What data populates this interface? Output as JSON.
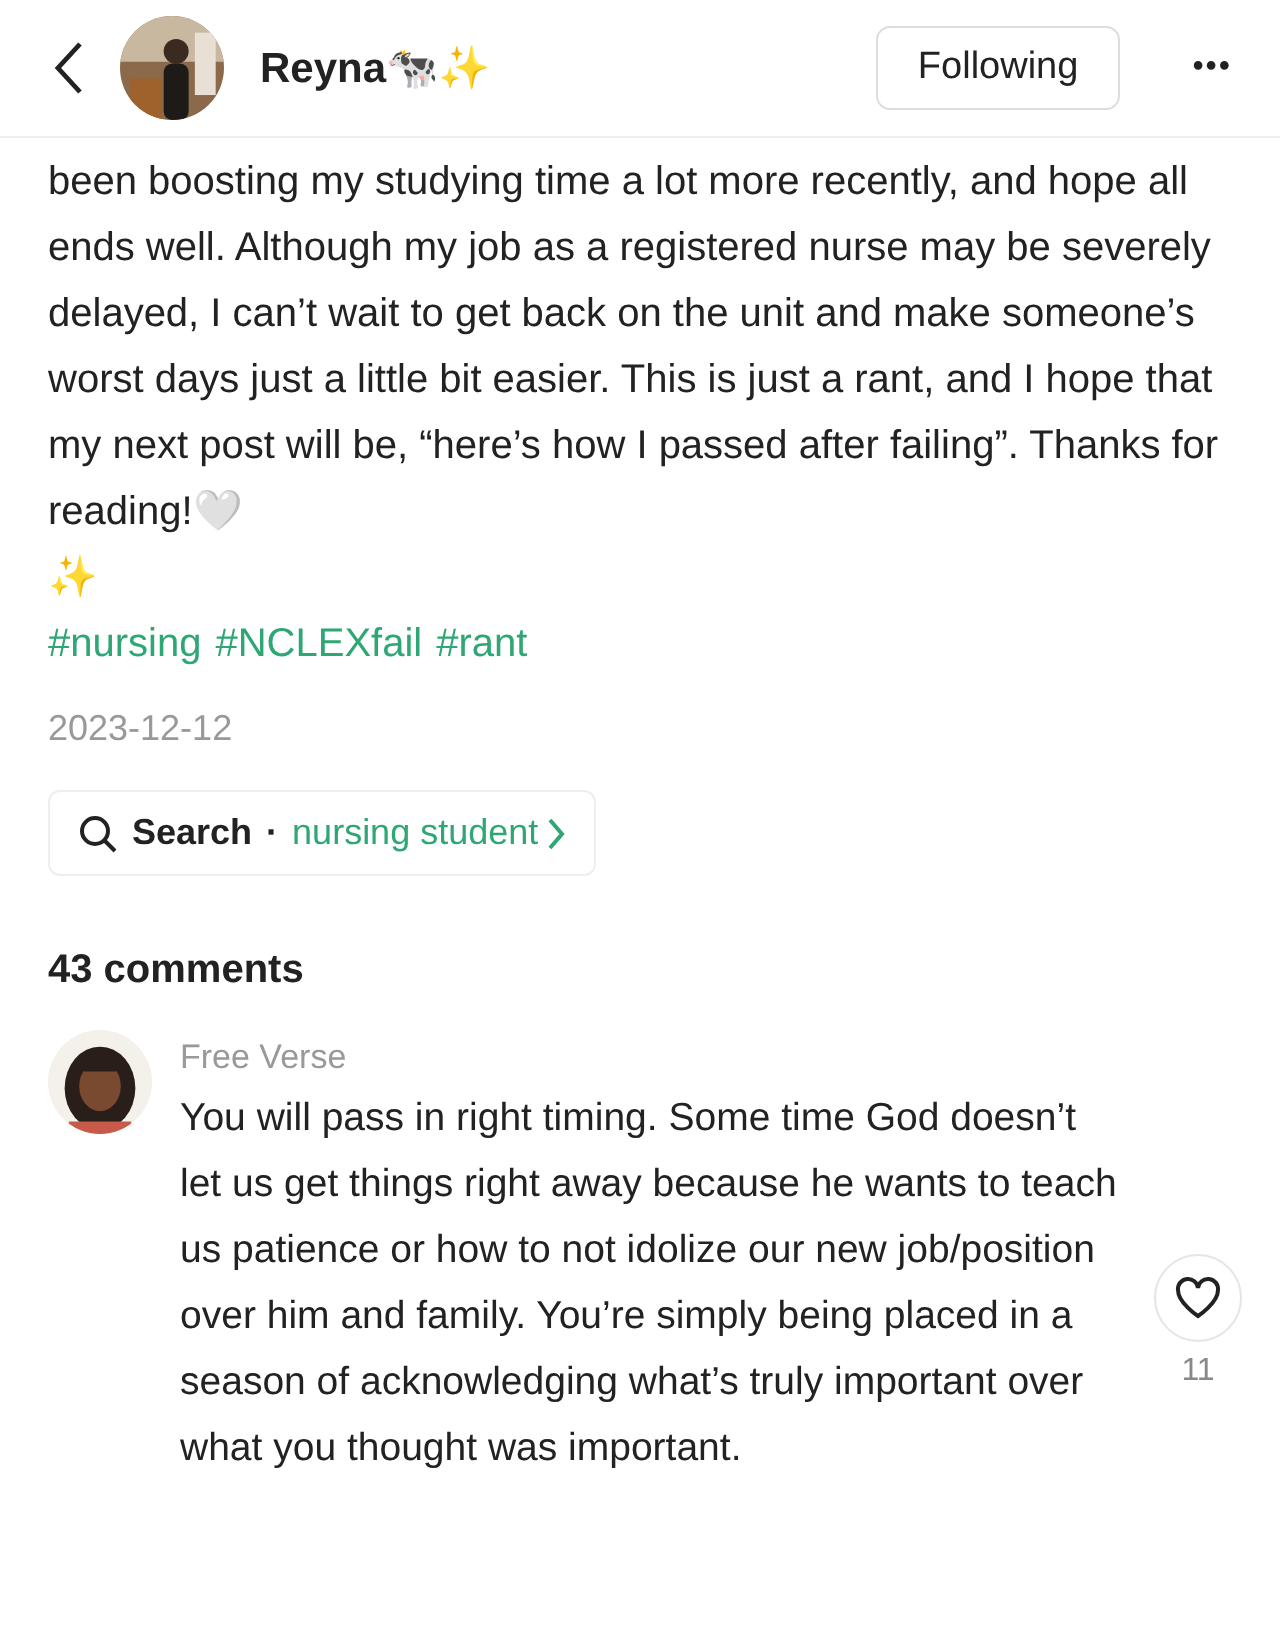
{
  "header": {
    "author": "Reyna🐄✨",
    "follow_button": "Following",
    "more": "•••"
  },
  "post": {
    "body": "been boosting my studying time a lot more recently, and hope all ends well. Although my job as a registered nurse may be severely delayed, I can’t wait to get back on the unit and make someone’s worst days just a little bit easier. This is just a rant, and I hope that my next post will be, “here’s how I passed after failing”. Thanks for reading!🤍",
    "sparkle": "✨",
    "hashtags": [
      "#nursing",
      "#NCLEXfail",
      "#rant"
    ],
    "date": "2023-12-12",
    "search": {
      "label": "Search",
      "dot": "·",
      "query": "nursing student"
    }
  },
  "comments_count": "43 comments",
  "comments": [
    {
      "author": "Free Verse",
      "text": "You will pass in right timing. Some time God doesn’t let us get things right away because he wants to teach us patience or how to not idolize our new job/position over him and family. You’re simply being placed in a season of acknowledging what’s truly important over what you thought was important.",
      "likes": "11",
      "liked": false
    }
  ]
}
